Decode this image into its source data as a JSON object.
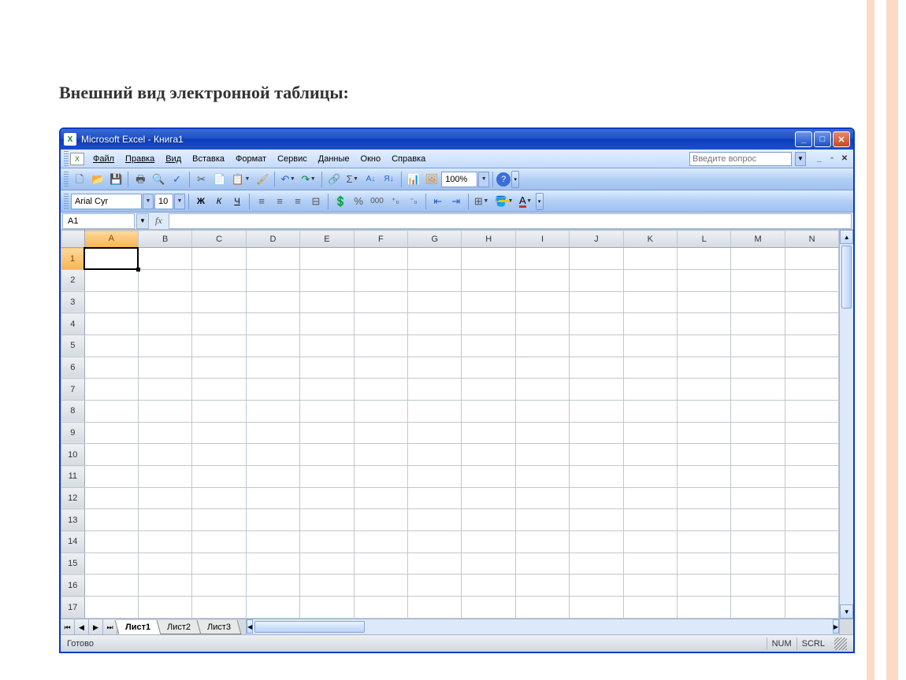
{
  "page_heading": "Внешний вид электронной таблицы:",
  "titlebar": {
    "app_icon": "X",
    "title": "Microsoft Excel - Книга1"
  },
  "menu": {
    "icon": "X",
    "items": [
      "Файл",
      "Правка",
      "Вид",
      "Вставка",
      "Формат",
      "Сервис",
      "Данные",
      "Окно",
      "Справка"
    ],
    "ask_placeholder": "Введите вопрос"
  },
  "toolbar1": {
    "new": "🗋",
    "open": "📂",
    "save": "💾",
    "print": "🖶",
    "preview": "🔍",
    "spell": "✓",
    "cut": "✂",
    "copy": "📄",
    "paste": "📋",
    "format_painter": "🖌",
    "undo": "↶",
    "redo": "↷",
    "hyperlink": "🔗",
    "autosum": "Σ",
    "sort_asc": "A↓",
    "sort_desc": "Я↓",
    "chart": "📊",
    "drawing": "🖼",
    "zoom": "100%",
    "help": "?"
  },
  "toolbar2": {
    "font_name": "Arial Cyr",
    "font_size": "10",
    "bold": "Ж",
    "italic": "К",
    "underline": "Ч",
    "align_left": "≡",
    "align_center": "≡",
    "align_right": "≡",
    "merge": "⊟",
    "currency": "💲",
    "percent": "%",
    "comma": "000",
    "inc_dec": "⁺₀",
    "dec_dec": "⁻₀",
    "dec_indent": "⇤",
    "inc_indent": "⇥",
    "borders": "⊞",
    "fill": "🪣",
    "font_color": "A"
  },
  "formula": {
    "name_box": "A1",
    "fx": "fx",
    "value": ""
  },
  "grid": {
    "columns": [
      "A",
      "B",
      "C",
      "D",
      "E",
      "F",
      "G",
      "H",
      "I",
      "J",
      "K",
      "L",
      "M",
      "N"
    ],
    "rows": [
      "1",
      "2",
      "3",
      "4",
      "5",
      "6",
      "7",
      "8",
      "9",
      "10",
      "11",
      "12",
      "13",
      "14",
      "15",
      "16",
      "17"
    ],
    "active_cell": "A1",
    "selected_col": "A",
    "selected_row": "1"
  },
  "sheets": {
    "tabs": [
      "Лист1",
      "Лист2",
      "Лист3"
    ],
    "active": "Лист1"
  },
  "status": {
    "ready": "Готово",
    "indicators": [
      "NUM",
      "SCRL"
    ]
  }
}
